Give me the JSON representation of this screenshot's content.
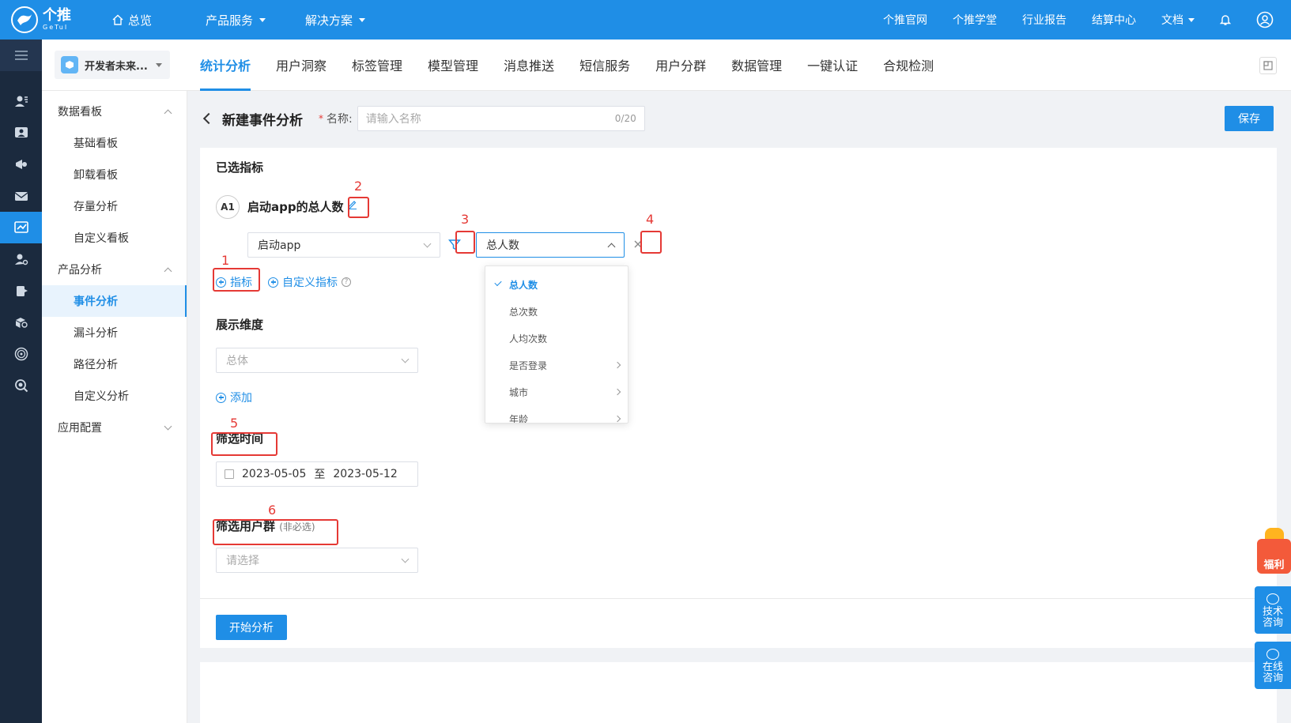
{
  "brand": {
    "cn": "个推",
    "en": "GeTuI"
  },
  "topnav": {
    "home": "总览",
    "products": "产品服务",
    "solutions": "解决方案"
  },
  "topright": {
    "site": "个推官网",
    "school": "个推学堂",
    "report": "行业报告",
    "billing": "结算中心",
    "docs": "文档"
  },
  "app_select": {
    "name": "开发者未来..."
  },
  "tabs": [
    "统计分析",
    "用户洞察",
    "标签管理",
    "模型管理",
    "消息推送",
    "短信服务",
    "用户分群",
    "数据管理",
    "一键认证",
    "合规检测"
  ],
  "menu": {
    "group1": "数据看板",
    "g1_items": [
      "基础看板",
      "卸载看板",
      "存量分析",
      "自定义看板"
    ],
    "group2": "产品分析",
    "g2_items": [
      "事件分析",
      "漏斗分析",
      "路径分析",
      "自定义分析"
    ],
    "group3": "应用配置"
  },
  "page": {
    "title": "新建事件分析",
    "req_mark": "*",
    "name_label": "名称:",
    "name_placeholder": "请输入名称",
    "name_count": "0/20",
    "save": "保存"
  },
  "metrics": {
    "section": "已选指标",
    "badge": "A1",
    "name": "启动app的总人数",
    "event": "启动app",
    "measure": "总人数",
    "add_metric": "指标",
    "add_custom": "自定义指标",
    "help": "?"
  },
  "dropdown": {
    "items": [
      {
        "label": "总人数",
        "selected": true,
        "sub": false
      },
      {
        "label": "总次数",
        "selected": false,
        "sub": false
      },
      {
        "label": "人均次数",
        "selected": false,
        "sub": false
      },
      {
        "label": "是否登录",
        "selected": false,
        "sub": true
      },
      {
        "label": "城市",
        "selected": false,
        "sub": true
      },
      {
        "label": "年龄",
        "selected": false,
        "sub": true
      }
    ]
  },
  "dimension": {
    "section": "展示维度",
    "placeholder": "总体",
    "add": "添加"
  },
  "time": {
    "section": "筛选时间",
    "start": "2023-05-05",
    "sep": "至",
    "end": "2023-05-12"
  },
  "usergroup": {
    "section": "筛选用户群",
    "optional": "(非必选)",
    "placeholder": "请选择"
  },
  "start_button": "开始分析",
  "annotations": [
    "1",
    "2",
    "3",
    "4",
    "5",
    "6"
  ],
  "float": {
    "gift": "福利",
    "tech": "技术咨询",
    "online": "在线咨询"
  },
  "colors": {
    "primary": "#1f8ee6",
    "rail": "#1b2a3e",
    "annotation": "#e53935"
  }
}
